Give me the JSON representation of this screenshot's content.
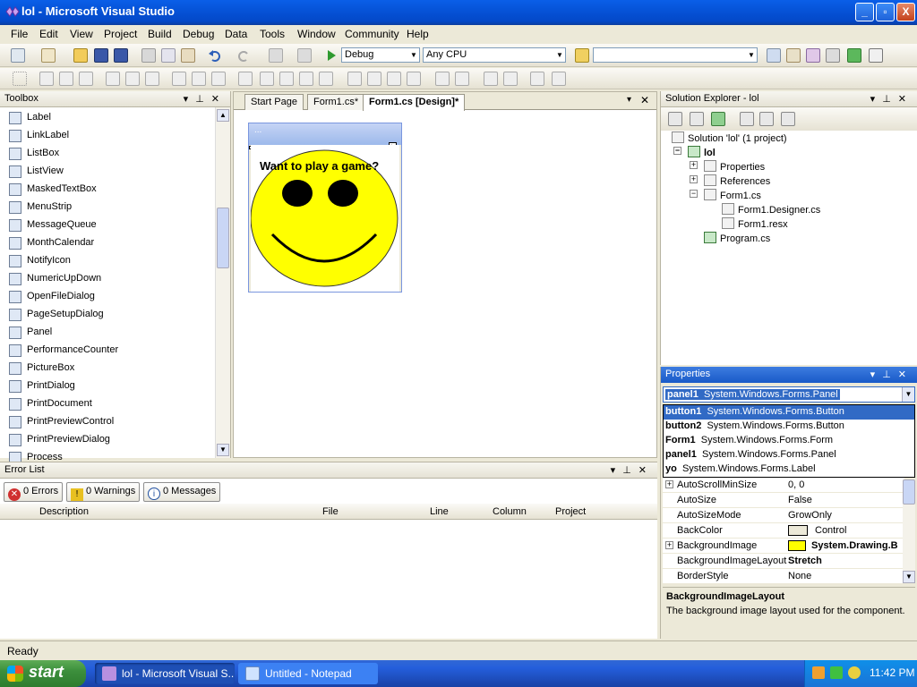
{
  "window": {
    "title": "lol - Microsoft Visual Studio",
    "minimize": "_",
    "maximize": "▫",
    "close": "X"
  },
  "menu": [
    "File",
    "Edit",
    "View",
    "Project",
    "Build",
    "Debug",
    "Data",
    "Tools",
    "Window",
    "Community",
    "Help"
  ],
  "toolbar": {
    "config": "Debug",
    "platform": "Any CPU",
    "find": ""
  },
  "toolbox": {
    "title": "Toolbox",
    "items": [
      "Label",
      "LinkLabel",
      "ListBox",
      "ListView",
      "MaskedTextBox",
      "MenuStrip",
      "MessageQueue",
      "MonthCalendar",
      "NotifyIcon",
      "NumericUpDown",
      "OpenFileDialog",
      "PageSetupDialog",
      "Panel",
      "PerformanceCounter",
      "PictureBox",
      "PrintDialog",
      "PrintDocument",
      "PrintPreviewControl",
      "PrintPreviewDialog",
      "Process"
    ]
  },
  "doc": {
    "tabs": [
      "Start Page",
      "Form1.cs*",
      "Form1.cs [Design]*"
    ],
    "form_title": "...",
    "form_text": "Want to play a game?"
  },
  "solution": {
    "title": "Solution Explorer - lol",
    "items": [
      "Solution 'lol' (1 project)",
      "lol",
      "Properties",
      "References",
      "Form1.cs",
      "Form1.Designer.cs",
      "Form1.resx",
      "Program.cs"
    ]
  },
  "properties": {
    "title": "Properties",
    "selected": {
      "name": "panel1",
      "type": "System.Windows.Forms.Panel"
    },
    "objects": [
      {
        "name": "button1",
        "type": "System.Windows.Forms.Button"
      },
      {
        "name": "button2",
        "type": "System.Windows.Forms.Button"
      },
      {
        "name": "Form1",
        "type": "System.Windows.Forms.Form"
      },
      {
        "name": "panel1",
        "type": "System.Windows.Forms.Panel"
      },
      {
        "name": "yo",
        "type": "System.Windows.Forms.Label"
      }
    ],
    "rows": [
      {
        "key": "AutoScrollMinSize",
        "value": "0, 0"
      },
      {
        "key": "AutoSize",
        "value": "False"
      },
      {
        "key": "AutoSizeMode",
        "value": "GrowOnly"
      },
      {
        "key": "BackColor",
        "value": "Control"
      },
      {
        "key": "BackgroundImage",
        "value": "System.Drawing.B"
      },
      {
        "key": "BackgroundImageLayout",
        "value": "Stretch"
      },
      {
        "key": "BorderStyle",
        "value": "None"
      }
    ],
    "desc_title": "BackgroundImageLayout",
    "desc_text": "The background image layout used for the component."
  },
  "errors": {
    "title": "Error List",
    "errors": "0 Errors",
    "warnings": "0 Warnings",
    "messages": "0 Messages",
    "columns": [
      "Description",
      "File",
      "Line",
      "Column",
      "Project"
    ]
  },
  "status": "Ready",
  "taskbar": {
    "start": "start",
    "tasks": [
      "lol - Microsoft Visual S...",
      "Untitled - Notepad"
    ],
    "time": "11:42 PM"
  }
}
